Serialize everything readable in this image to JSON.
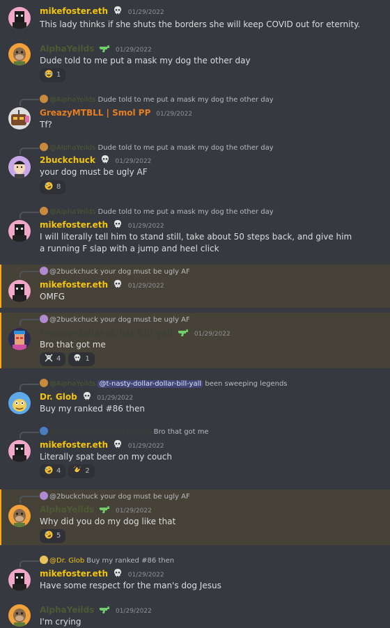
{
  "messages": [
    {
      "id": "m1",
      "type": "default",
      "author": "mikefoster.eth",
      "author_style": "gold",
      "badge": "skull-icon",
      "timestamp": "01/29/2022",
      "text": "This lady thinks if she shuts the borders she will keep COVID out for eternity.",
      "avatar": "pink"
    },
    {
      "id": "m2",
      "type": "default",
      "author": "AlphaYeilds",
      "author_style": "olive",
      "badge": "gun-icon",
      "timestamp": "01/29/2022",
      "text": "Dude told to me put a mask my dog the other day",
      "avatar": "ape",
      "reactions": [
        {
          "emoji": "joy-emoji-icon",
          "count": "1"
        }
      ]
    },
    {
      "id": "m3",
      "type": "reply",
      "reply_to": {
        "author": "@AlphaYeilds",
        "text": "Dude told to me put a mask my dog the other day"
      },
      "author": "GreazyMTBLL | Smol PP",
      "author_style": "orange",
      "badge": "",
      "timestamp": "01/29/2022",
      "text": "Tf?",
      "avatar": "robot"
    },
    {
      "id": "m4",
      "type": "reply",
      "reply_to": {
        "author": "@AlphaYeilds",
        "text": "Dude told to me put a mask my dog the other day"
      },
      "author": "2buckchuck",
      "author_style": "gold",
      "badge": "skull-icon",
      "timestamp": "01/29/2022",
      "text": "your dog must be ugly AF",
      "avatar": "purple",
      "reactions": [
        {
          "emoji": "rofl-emoji-icon",
          "count": "8"
        }
      ]
    },
    {
      "id": "m5",
      "type": "reply",
      "reply_to": {
        "author": "@AlphaYeilds",
        "text": "Dude told to me put a mask my dog the other day"
      },
      "author": "mikefoster.eth",
      "author_style": "gold",
      "badge": "skull-icon",
      "timestamp": "01/29/2022",
      "text": "I will literally tell him to stand still, take about 50 steps back, and give him a running F slap with a jump and heel click",
      "avatar": "pink"
    },
    {
      "id": "m6",
      "type": "reply",
      "highlight": true,
      "reply_to": {
        "author": "@2buckchuck",
        "text": "your dog must be ugly AF"
      },
      "author": "mikefoster.eth",
      "author_style": "gold",
      "badge": "skull-icon",
      "timestamp": "01/29/2022",
      "text": "OMFG",
      "avatar": "pink"
    },
    {
      "id": "m7",
      "type": "reply",
      "highlight": true,
      "reply_to": {
        "author": "@2buckchuck",
        "text": "your dog must be ugly AF"
      },
      "author": "t-nasty-dollar-dollar-bill-yall",
      "author_style": "dark",
      "badge": "gun-icon",
      "timestamp": "01/29/2022",
      "text": "Bro that got me",
      "avatar": "punk",
      "reactions": [
        {
          "emoji": "skull-crossbones-emoji-icon",
          "count": "4"
        },
        {
          "emoji": "skull-emoji-icon",
          "count": "1"
        }
      ]
    },
    {
      "id": "m8",
      "type": "reply",
      "reply_to": {
        "author": "@AlphaYeilds",
        "mention": "@t-nasty-dollar-dollar-bill-yall",
        "text": "been sweeping legends"
      },
      "author": "Dr. Glob",
      "author_style": "gold",
      "badge": "skull-icon",
      "timestamp": "01/29/2022",
      "text": "Buy my ranked #86 then",
      "avatar": "glob"
    },
    {
      "id": "m9",
      "type": "reply",
      "reply_to": {
        "author": "@t-nasty-dollar-dollar-bill-yall",
        "text": "Bro that got me"
      },
      "author": "mikefoster.eth",
      "author_style": "gold",
      "badge": "skull-icon",
      "timestamp": "01/29/2022",
      "text": "Literally spat beer on my couch",
      "avatar": "pink",
      "reactions": [
        {
          "emoji": "rofl-emoji-icon",
          "count": "4"
        },
        {
          "emoji": "clap-emoji-icon",
          "count": "2"
        }
      ]
    },
    {
      "id": "m10",
      "type": "reply",
      "highlight": true,
      "reply_to": {
        "author": "@2buckchuck",
        "text": "your dog must be ugly AF"
      },
      "author": "AlphaYeilds",
      "author_style": "olive",
      "badge": "gun-icon",
      "timestamp": "01/29/2022",
      "text": "Why did you do my dog like that",
      "avatar": "ape",
      "reactions": [
        {
          "emoji": "rofl-emoji-icon",
          "count": "5"
        }
      ]
    },
    {
      "id": "m11",
      "type": "reply",
      "reply_to": {
        "author": "@Dr. Glob",
        "text": "Buy my ranked #86 then"
      },
      "author": "mikefoster.eth",
      "author_style": "gold",
      "badge": "skull-icon",
      "timestamp": "01/29/2022",
      "text": "Have some respect for the man's dog Jesus",
      "avatar": "pink"
    },
    {
      "id": "m12",
      "type": "default",
      "author": "AlphaYeilds",
      "author_style": "olive",
      "badge": "gun-icon",
      "timestamp": "01/29/2022",
      "text": "I'm crying",
      "avatar": "ape"
    }
  ]
}
